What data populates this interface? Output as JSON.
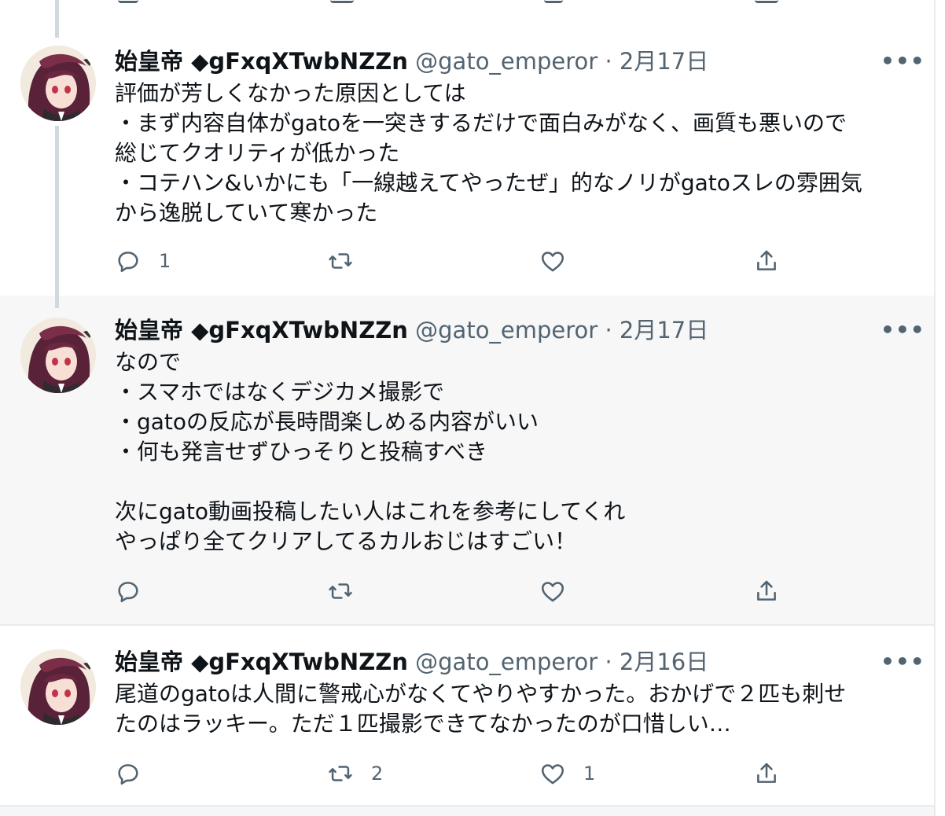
{
  "tweets": [
    {
      "name": "始皇帝 ◆gFxqXTwbNZZn",
      "handle": "@gato_emperor",
      "separator": "·",
      "date": "2月17日",
      "more": "•••",
      "text": "評価が芳しくなかった原因としては\n・まず内容自体がgatoを一突きするだけで面白みがなく、画質も悪いので\n総じてクオリティが低かった\n・コテハン&いかにも「一線越えてやったぜ」的なノリがgatoスレの雰囲気\nから逸脱していて寒かった",
      "replies": "1",
      "retweets": "",
      "likes": ""
    },
    {
      "name": "始皇帝 ◆gFxqXTwbNZZn",
      "handle": "@gato_emperor",
      "separator": "·",
      "date": "2月17日",
      "more": "•••",
      "text": "なので\n・スマホではなくデジカメ撮影で\n・gatoの反応が長時間楽しめる内容がいい\n・何も発言せずひっそりと投稿すべき\n\n次にgato動画投稿したい人はこれを参考にしてくれ\nやっぱり全てクリアしてるカルおじはすごい！",
      "replies": "",
      "retweets": "",
      "likes": ""
    },
    {
      "name": "始皇帝 ◆gFxqXTwbNZZn",
      "handle": "@gato_emperor",
      "separator": "·",
      "date": "2月16日",
      "more": "•••",
      "text": "尾道のgatoは人間に警戒心がなくてやりやすかった。おかげで２匹も刺せ\nたのはラッキー。ただ１匹撮影できてなかったのが口惜しい…",
      "replies": "",
      "retweets": "2",
      "likes": "1"
    }
  ],
  "icons": {
    "reply": "reply-icon",
    "retweet": "retweet-icon",
    "like": "heart-icon",
    "share": "share-icon",
    "more": "more-icon"
  },
  "colors": {
    "text": "#0f1419",
    "muted": "#536471",
    "hover_bg": "#f7f7f8",
    "thread_line": "#cfd9de"
  }
}
